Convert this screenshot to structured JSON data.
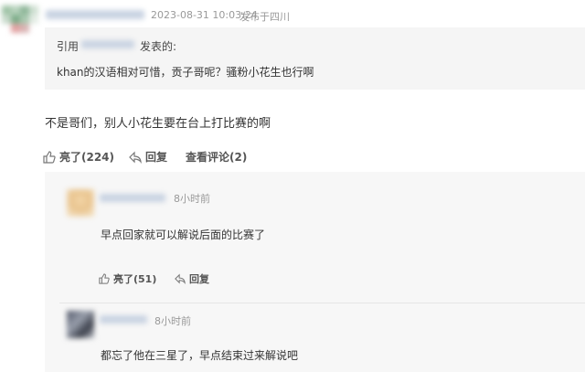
{
  "post": {
    "timestamp": "2023-08-31 10:03:24",
    "location": "发布于四川",
    "quote": {
      "prefix": "引用",
      "suffix": "发表的:",
      "text": "khan的汉语相对可惜，贡子哥呢？骚粉小花生也行啊"
    },
    "comment": "不是哥们，别人小花生要在台上打比赛的啊",
    "actions": {
      "like": "亮了(224)",
      "reply": "回复",
      "view_replies": "查看评论(2)"
    }
  },
  "replies": [
    {
      "time": "8小时前",
      "text": "早点回家就可以解说后面的比赛了",
      "like": "亮了(51)",
      "reply": "回复"
    },
    {
      "time": "8小时前",
      "text": "都忘了他在三星了，早点结束过来解说吧"
    }
  ],
  "colors": {
    "quote_bg": "#f5f5f5",
    "panel_bg": "#f7f7f7",
    "meta": "#999999"
  }
}
